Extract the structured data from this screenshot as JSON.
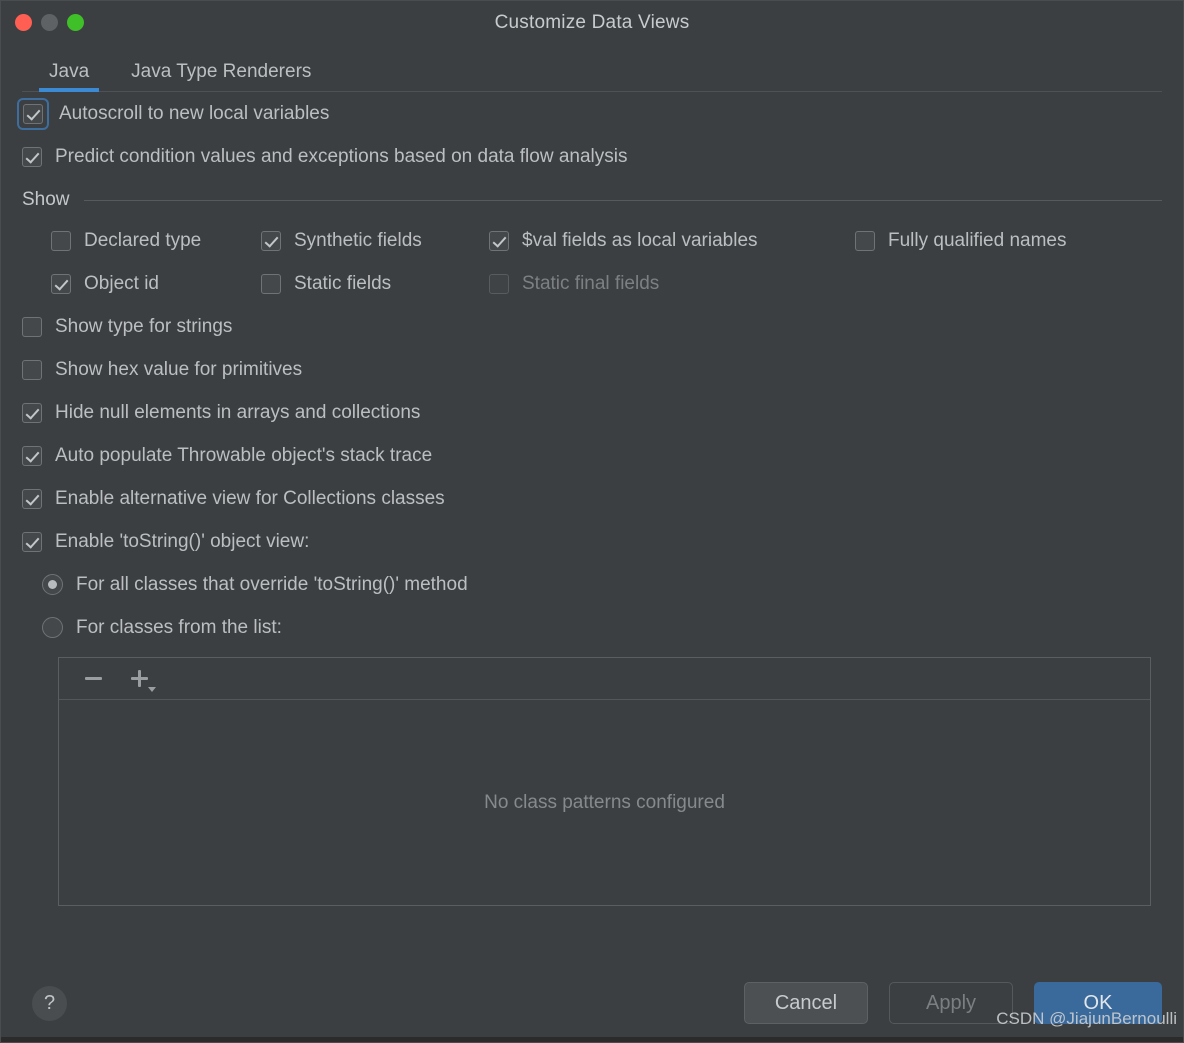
{
  "window": {
    "title": "Customize Data Views",
    "traffic_lights": [
      "close-button",
      "minimize-button",
      "maximize-button"
    ]
  },
  "tabs": [
    {
      "label": "Java",
      "active": true
    },
    {
      "label": "Java Type Renderers",
      "active": false
    }
  ],
  "top_options": [
    {
      "label": "Autoscroll to new local variables",
      "checked": true,
      "focused": true
    },
    {
      "label": "Predict condition values and exceptions based on data flow analysis",
      "checked": true,
      "focused": false
    }
  ],
  "show_group": {
    "title": "Show",
    "rows": [
      [
        {
          "label": "Declared type",
          "checked": false,
          "enabled": true
        },
        {
          "label": "Synthetic fields",
          "checked": true,
          "enabled": true
        },
        {
          "label": "$val fields as local variables",
          "checked": true,
          "enabled": true
        },
        {
          "label": "Fully qualified names",
          "checked": false,
          "enabled": true
        }
      ],
      [
        {
          "label": "Object id",
          "checked": true,
          "enabled": true
        },
        {
          "label": "Static fields",
          "checked": false,
          "enabled": true
        },
        {
          "label": "Static final fields",
          "checked": false,
          "enabled": false
        }
      ]
    ]
  },
  "main_options": [
    {
      "label": "Show type for strings",
      "checked": false
    },
    {
      "label": "Show hex value for primitives",
      "checked": false
    },
    {
      "label": "Hide null elements in arrays and collections",
      "checked": true
    },
    {
      "label": "Auto populate Throwable object's stack trace",
      "checked": true
    },
    {
      "label": "Enable alternative view for Collections classes",
      "checked": true
    },
    {
      "label": "Enable 'toString()' object view:",
      "checked": true
    }
  ],
  "tostring_radios": [
    {
      "label": "For all classes that override 'toString()' method",
      "selected": true
    },
    {
      "label": "For classes from the list:",
      "selected": false
    }
  ],
  "class_list": {
    "toolbar": {
      "remove_label": "remove-pattern",
      "add_label": "add-pattern"
    },
    "empty_text": "No class patterns configured"
  },
  "footer": {
    "help_label": "?",
    "cancel_label": "Cancel",
    "apply_label": "Apply",
    "apply_enabled": false,
    "ok_label": "OK"
  },
  "watermark": "CSDN @JiajunBernoulli",
  "colors": {
    "window_bg": "#3c3f41",
    "accent_blue": "#3d8ad4",
    "primary_button": "#3a699c",
    "text": "#bcbfc1",
    "text_disabled": "#7d8082",
    "traffic_close": "#ff5f52",
    "traffic_min": "#5f6265",
    "traffic_max": "#3fbf28"
  }
}
